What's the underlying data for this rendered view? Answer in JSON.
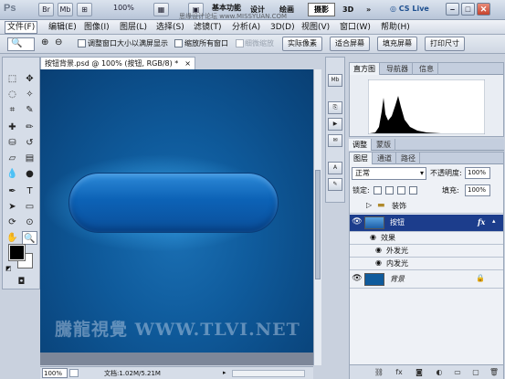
{
  "app": {
    "logo": "Ps",
    "mini_buttons": [
      "Br",
      "Mb"
    ],
    "zoom": "100%",
    "workspace_buttons": [
      "基本功能",
      "设计",
      "绘画",
      "摄影"
    ],
    "right_buttons": [
      "3D",
      "»"
    ],
    "cs_live": "CS Live",
    "header_watermark": "思缘设计论坛 www.MISSYUAN.COM"
  },
  "menubar": {
    "items": [
      "文件(F)",
      "编辑(E)",
      "图像(I)",
      "图层(L)",
      "选择(S)",
      "滤镜(T)",
      "分析(A)",
      "3D(D)",
      "视图(V)",
      "窗口(W)",
      "帮助(H)"
    ]
  },
  "options": {
    "resize_windows": "调整窗口大小以满屏显示",
    "zoom_all": "缩放所有窗口",
    "scrubby_zoom": "细微缩放",
    "actual_pixels": "实际像素",
    "fit_screen": "适合屏幕",
    "fill_screen": "填充屏幕",
    "print_size": "打印尺寸"
  },
  "document": {
    "tab_title": "按钮背景.psd @ 100% (按钮, RGB/8) *",
    "watermark": "騰龍視覺 WWW.TLVI.NET",
    "zoom": "100%",
    "doc_size": "文档:1.02M/5.21M"
  },
  "panels": {
    "histogram_tabs": [
      "直方图",
      "导航器",
      "信息"
    ],
    "adjust_tabs": [
      "调整",
      "蒙版"
    ],
    "layer_tabs": [
      "图层",
      "通道",
      "路径"
    ],
    "blend_mode": "正常",
    "opacity_label": "不透明度:",
    "opacity": "100%",
    "lock_label": "锁定:",
    "fill_label": "填充:",
    "fill": "100%",
    "layers": [
      {
        "name": "装饰"
      },
      {
        "name": "按钮"
      },
      {
        "name": "效果"
      },
      {
        "name": "外发光"
      },
      {
        "name": "内发光"
      },
      {
        "name": "背景"
      }
    ]
  },
  "colors": {
    "canvas": "#0f5b9c",
    "button": "#0c62b6",
    "selected_layer": "#1c3d8c"
  }
}
